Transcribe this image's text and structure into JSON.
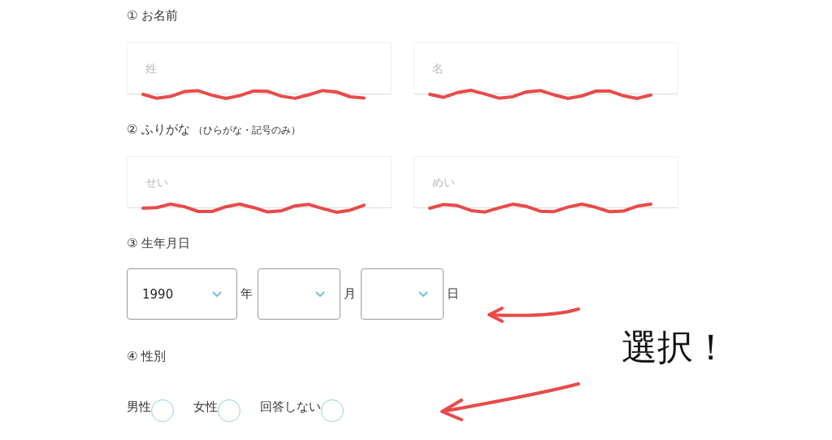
{
  "sections": [
    {
      "kind": "text_pair",
      "heading": "① お名前",
      "fields": [
        {
          "placeholder": "姓",
          "scribbled": true
        },
        {
          "placeholder": "名",
          "scribbled": true
        }
      ]
    },
    {
      "kind": "text_pair",
      "heading": "② ふりがな",
      "note": "（ひらがな・記号のみ）",
      "fields": [
        {
          "placeholder": "せい",
          "scribbled": true
        },
        {
          "placeholder": "めい",
          "scribbled": true
        }
      ]
    },
    {
      "kind": "date",
      "heading": "③ 生年月日",
      "selects": [
        {
          "value": "1990",
          "unit": "年"
        },
        {
          "unit": "月"
        },
        {
          "unit": "日"
        }
      ]
    },
    {
      "kind": "radio",
      "heading": "④ 性別",
      "options": [
        {
          "label": "男性",
          "selected": false
        },
        {
          "label": "女性",
          "selected": false
        },
        {
          "label": "回答しない",
          "selected": false
        }
      ]
    }
  ],
  "annotation": {
    "text": "選択！"
  }
}
